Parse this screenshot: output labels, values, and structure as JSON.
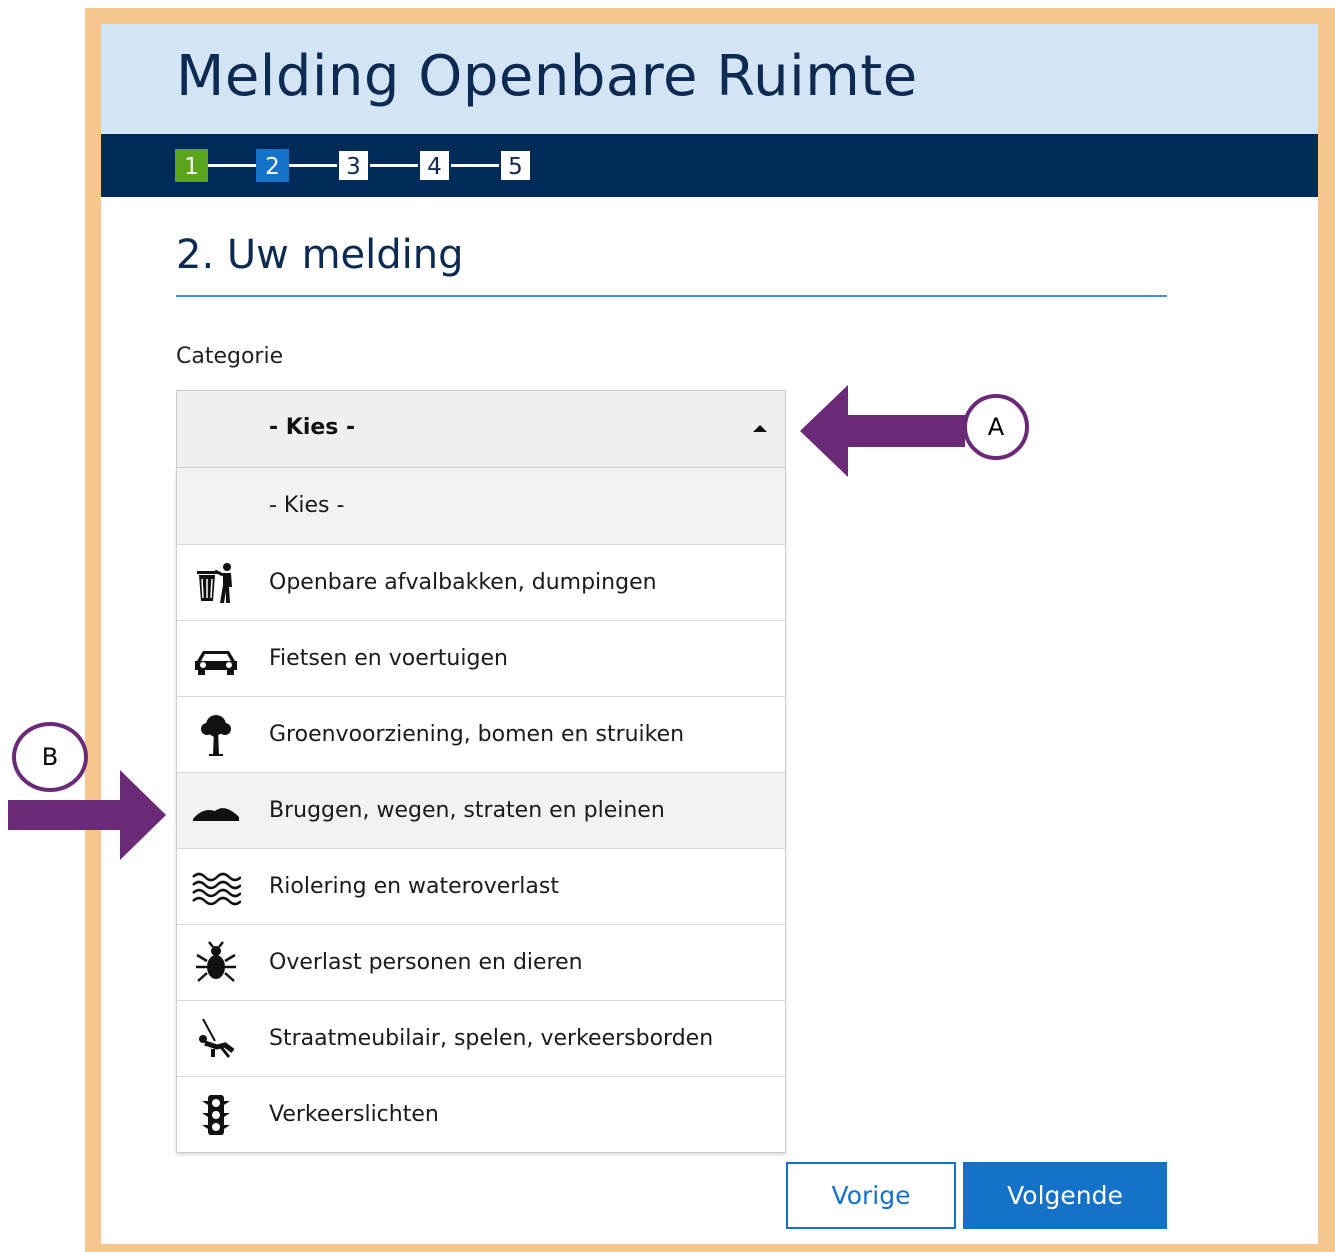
{
  "header": {
    "title": "Melding Openbare Ruimte"
  },
  "steps": [
    {
      "label": "1",
      "state": "done"
    },
    {
      "label": "2",
      "state": "active"
    },
    {
      "label": "3",
      "state": "todo"
    },
    {
      "label": "4",
      "state": "todo"
    },
    {
      "label": "5",
      "state": "todo"
    }
  ],
  "section": {
    "title": "2. Uw melding"
  },
  "category": {
    "label": "Categorie",
    "selected": "- Kies -",
    "expanded": true,
    "options": [
      {
        "label": "- Kies -",
        "icon": ""
      },
      {
        "label": "Openbare afvalbakken, dumpingen",
        "icon": "trash-person-icon"
      },
      {
        "label": "Fietsen en voertuigen",
        "icon": "car-icon"
      },
      {
        "label": "Groenvoorziening, bomen en struiken",
        "icon": "tree-icon"
      },
      {
        "label": "Bruggen, wegen, straten en pleinen",
        "icon": "bridge-icon"
      },
      {
        "label": "Riolering en wateroverlast",
        "icon": "water-waves-icon"
      },
      {
        "label": "Overlast personen en dieren",
        "icon": "bug-icon"
      },
      {
        "label": "Straatmeubilair, spelen, verkeersborden",
        "icon": "swing-icon"
      },
      {
        "label": "Verkeerslichten",
        "icon": "traffic-light-icon"
      }
    ]
  },
  "buttons": {
    "prev": "Vorige",
    "next": "Volgende"
  },
  "annotations": {
    "a": "A",
    "b": "B",
    "color": "#6a2a78"
  },
  "colors": {
    "frame": "#f5c68d",
    "header_bg": "#d3e4f5",
    "stepbar_bg": "#002a57",
    "accent": "#1572c9",
    "done": "#5aa51a"
  }
}
